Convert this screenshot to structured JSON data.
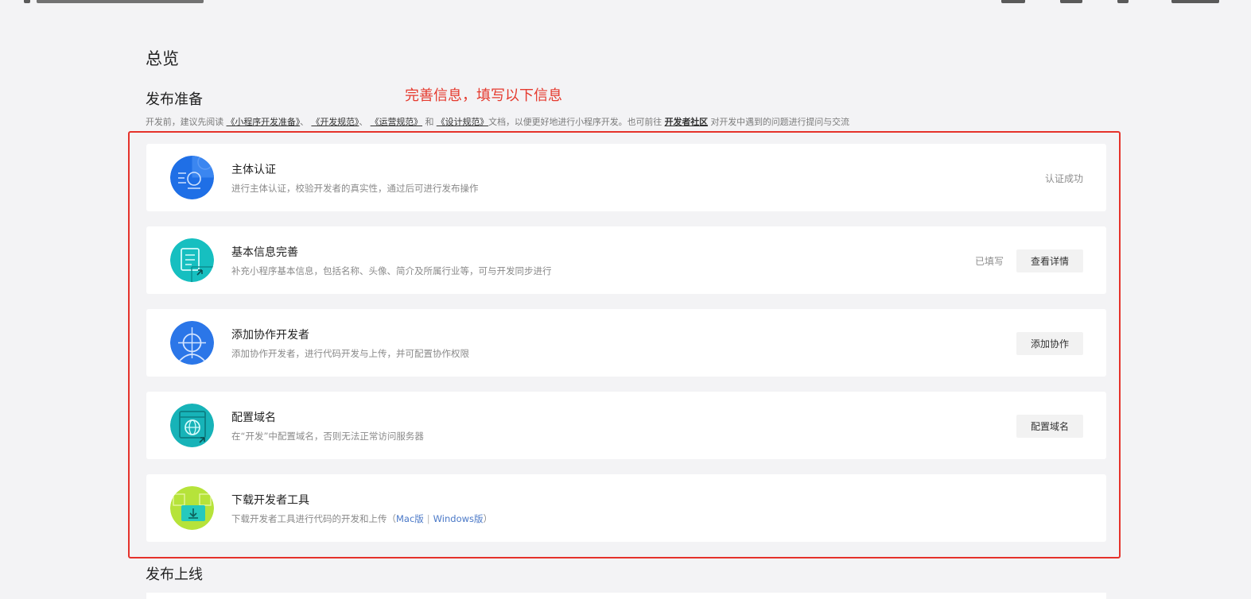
{
  "page": {
    "title": "总览",
    "annotation": "完善信息，填写以下信息"
  },
  "prepare": {
    "title": "发布准备",
    "intro": {
      "prefix": "开发前，建议先阅读",
      "link1": "《小程序开发准备》",
      "sep1": "、",
      "link2": "《开发规范》",
      "sep2": "、",
      "link3": "《运营规范》",
      "and": " 和 ",
      "link4": "《设计规范》",
      "middle": "文档，以便更好地进行小程序开发。也可前往 ",
      "community": "开发者社区",
      "suffix": " 对开发中遇到的问题进行提问与交流"
    }
  },
  "cards": [
    {
      "title": "主体认证",
      "desc": "进行主体认证，校验开发者的真实性，通过后可进行发布操作",
      "status": "认证成功",
      "icon": "id-card-icon",
      "color": "#1f6fe6"
    },
    {
      "title": "基本信息完善",
      "desc": "补充小程序基本信息，包括名称、头像、简介及所属行业等，可与开发同步进行",
      "status": "已填写",
      "button": "查看详情",
      "icon": "form-edit-icon",
      "color": "#16bfc0"
    },
    {
      "title": "添加协作开发者",
      "desc": "添加协作开发者，进行代码开发与上传，并可配置协作权限",
      "button": "添加协作",
      "icon": "user-add-icon",
      "color": "#2b76e8"
    },
    {
      "title": "配置域名",
      "desc": "在“开发”中配置域名，否则无法正常访问服务器",
      "button": "配置域名",
      "icon": "globe-window-icon",
      "color": "#17b3b8"
    },
    {
      "title": "下载开发者工具",
      "desc": "下载开发者工具进行代码的开发和上传（",
      "mac": "Mac版",
      "divider": "|",
      "windows": "Windows版",
      "desc_end": "）",
      "icon": "download-icon",
      "color": "#b6e33a"
    }
  ],
  "publish": {
    "title": "发布上线"
  }
}
